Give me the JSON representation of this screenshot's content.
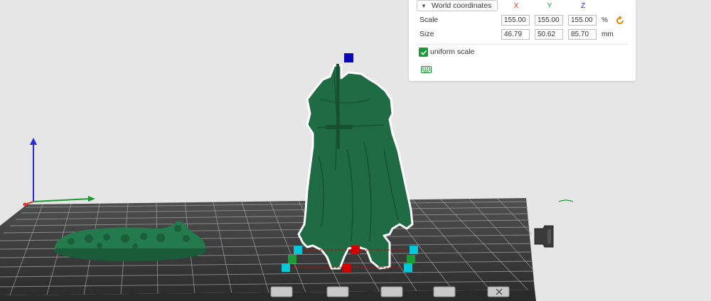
{
  "panel": {
    "coordinate_mode": "World coordinates",
    "axes": {
      "x": "X",
      "y": "Y",
      "z": "Z"
    },
    "scale": {
      "label": "Scale",
      "x": "155.00",
      "y": "155.00",
      "z": "155.00",
      "unit": "%"
    },
    "size": {
      "label": "Size",
      "x": "46.79",
      "y": "50.62",
      "z": "85.70",
      "unit": "mm"
    },
    "uniform_scale": {
      "label": "uniform scale",
      "checked": true
    }
  },
  "colors": {
    "accent": "#1a9b36",
    "model": "#1f6b43",
    "axis_x": "#e33333",
    "axis_y": "#1a9b36",
    "axis_z": "#2a2ad8",
    "handle_center": "#d40000",
    "handle_corner": "#00c8d8",
    "handle_top": "#0a0ab4"
  },
  "icons": {
    "dropdown": "chevron-down-icon",
    "reset": "reset-scale-icon",
    "keyboard": "keyboard-icon"
  }
}
